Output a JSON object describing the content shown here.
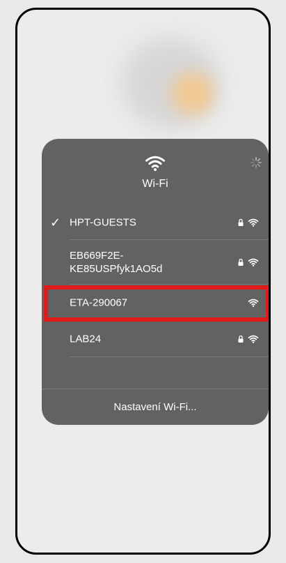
{
  "panel": {
    "title": "Wi-Fi",
    "header_icon": "wifi-icon",
    "status_icon": "spinner-icon",
    "settings_label": "Nastavení Wi-Fi..."
  },
  "networks": [
    {
      "name": "HPT-GUESTS",
      "connected": true,
      "secured": true
    },
    {
      "name": "EB669F2E-\nKE85USPfyk1AO5d",
      "connected": false,
      "secured": true
    },
    {
      "name": "ETA-290067",
      "connected": false,
      "secured": false,
      "highlighted": true
    },
    {
      "name": "LAB24",
      "connected": false,
      "secured": true
    }
  ],
  "symbols": {
    "checkmark": "✓"
  },
  "colors": {
    "highlight": "#e11b1b",
    "panel_bg": "#626262"
  }
}
